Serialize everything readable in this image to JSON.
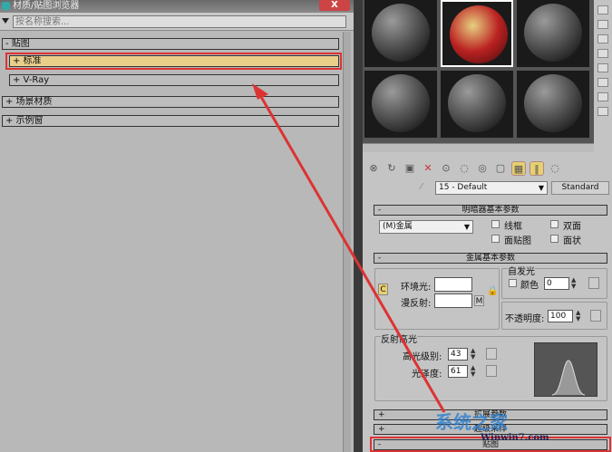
{
  "window": {
    "title": "材质/贴图浏览器",
    "close": "X"
  },
  "browser": {
    "search_placeholder": "按名称搜索...",
    "groups": [
      {
        "label": "- 贴图"
      },
      {
        "label": "+ 标准"
      },
      {
        "label": "+ V-Ray"
      },
      {
        "label": "+ 场景材质"
      },
      {
        "label": "+ 示例窗"
      }
    ]
  },
  "editor": {
    "material_name": "15 - Default",
    "material_type": "Standard",
    "shader_rollout": "明暗器基本参数",
    "shader": "(M)金属",
    "options": [
      "线框",
      "双面",
      "面贴图",
      "面状"
    ],
    "metal_rollout": "金属基本参数",
    "ambient": "环境光:",
    "diffuse": "漫反射:",
    "map_btn": "M",
    "lock_btn": "C",
    "self_illum": "自发光",
    "color_label": "颜色",
    "color_value": "0",
    "opacity_label": "不透明度:",
    "opacity_value": "100",
    "specular": "反射高光",
    "spec_level_label": "高光级别:",
    "spec_level": "43",
    "gloss_label": "光泽度:",
    "gloss": "61",
    "bottom_rollouts": [
      "扩展参数",
      "超级采样",
      "贴图"
    ]
  },
  "watermark": {
    "text": "系统之家",
    "url": "Winwin7.com"
  },
  "colors": {
    "highlight": "#e9cf8a",
    "annotation": "#d33"
  }
}
